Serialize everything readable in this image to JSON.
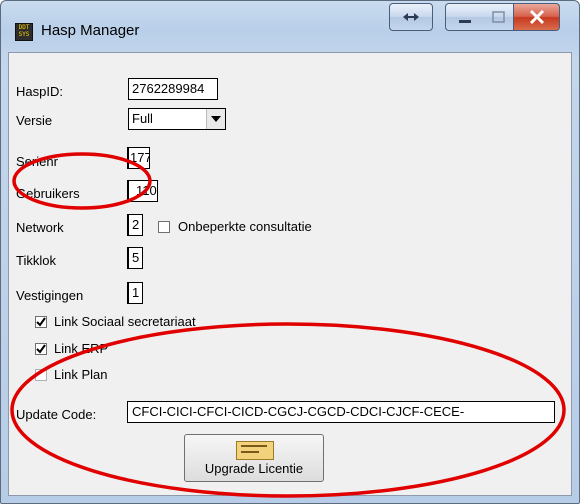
{
  "window": {
    "title": "Hasp Manager",
    "app_icon_text": [
      "DDT",
      "SYS"
    ],
    "controls": [
      "resize-icon",
      "minimize-icon",
      "maximize-icon",
      "close-icon"
    ]
  },
  "form": {
    "haspid": {
      "label": "HaspID:",
      "value": "2762289984"
    },
    "versie": {
      "label": "Versie",
      "value": "Full"
    },
    "serienr": {
      "label": "Serienr",
      "value": "177"
    },
    "gebruikers": {
      "label": "Gebruikers",
      "value": "110"
    },
    "network": {
      "label": "Network",
      "value": "2"
    },
    "onbeperkte": {
      "label": "Onbeperkte consultatie",
      "checked": false
    },
    "tikklok": {
      "label": "Tikklok",
      "value": "5"
    },
    "vestigingen": {
      "label": "Vestigingen",
      "value": "1"
    },
    "link_sociaal": {
      "label": "Link Sociaal secretariaat",
      "checked": true
    },
    "link_erp": {
      "label": "Link ERP",
      "checked": true
    },
    "link_plan": {
      "label": "Link Plan",
      "checked": false
    },
    "update_code": {
      "label": "Update Code:",
      "value": "CFCI-CICI-CFCI-CICD-CGCJ-CGCD-CDCI-CJCF-CECE-"
    },
    "upgrade_button": {
      "label": "Upgrade Licentie"
    }
  },
  "annotation_color": "#e00000"
}
